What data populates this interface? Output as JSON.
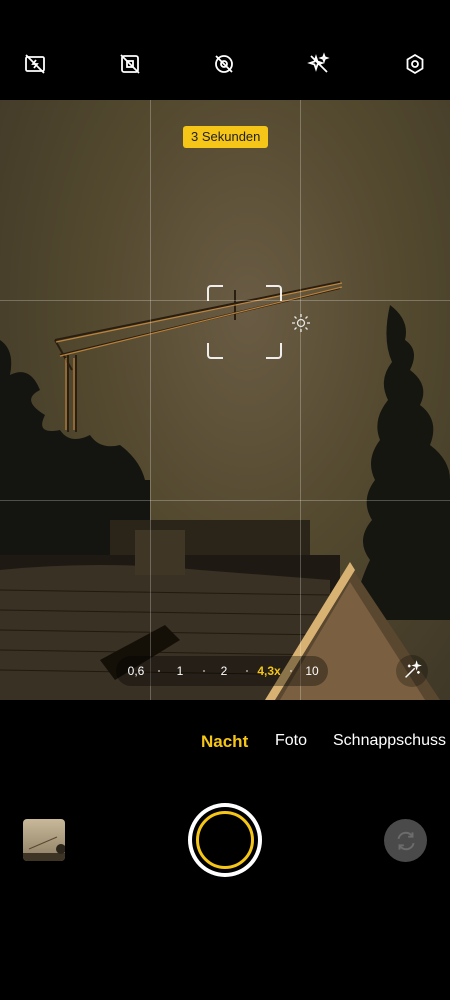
{
  "top_bar": {
    "icons": [
      "flash-off-icon",
      "live-photo-off-icon",
      "motion-off-icon",
      "ai-enhance-icon",
      "settings-icon"
    ]
  },
  "viewfinder": {
    "timer_badge": "3 Sekunden",
    "zoom": {
      "options": [
        "0,6",
        "1",
        "2",
        "4,3x",
        "10"
      ],
      "selected": "4,3x"
    }
  },
  "modes": {
    "items": [
      "Nacht",
      "Foto",
      "Schnappschuss"
    ],
    "selected": "Nacht"
  },
  "colors": {
    "accent": "#f5c518",
    "background": "#000000"
  }
}
